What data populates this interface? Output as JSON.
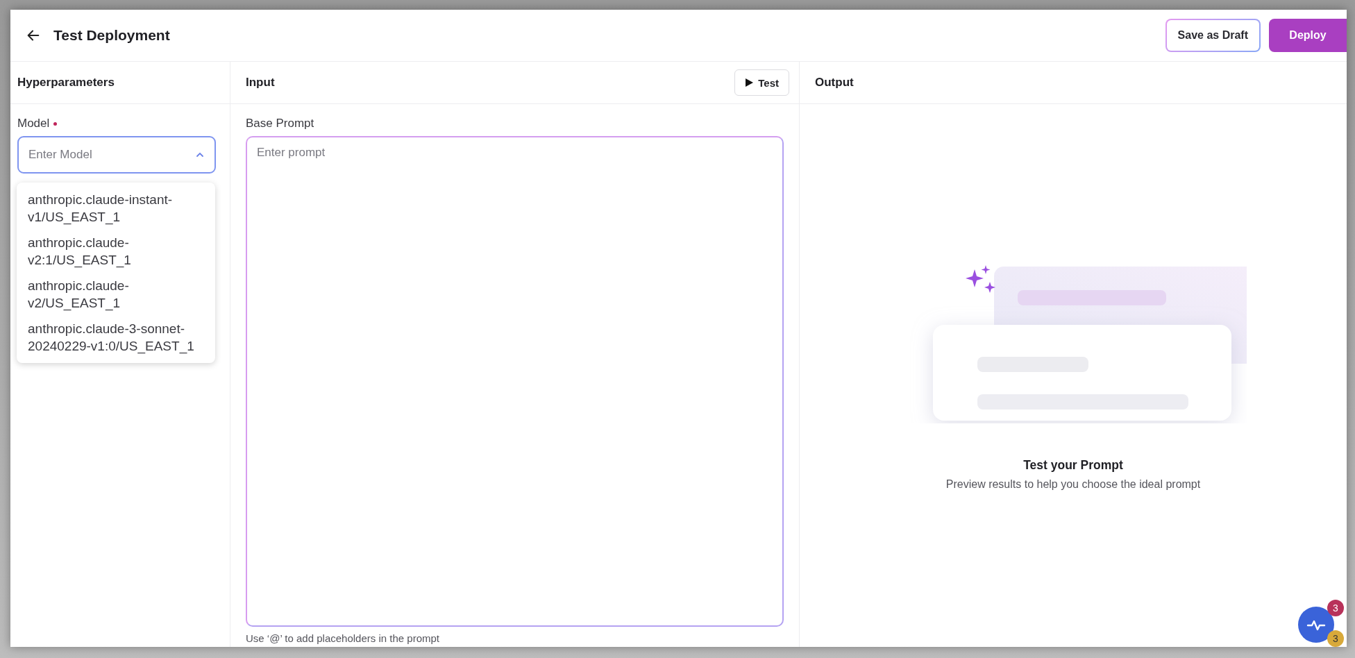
{
  "header": {
    "title": "Test Deployment",
    "buttons": [
      {
        "label": "Save as Draft",
        "kind": "outline"
      },
      {
        "label": "Deploy",
        "kind": "primary"
      }
    ]
  },
  "hyperparameters": {
    "heading": "Hyperparameters",
    "model_field": {
      "label": "Model",
      "required": true,
      "placeholder": "Enter Model",
      "expanded": true,
      "options": [
        "anthropic.claude-instant-v1/US_EAST_1",
        "anthropic.claude-v2:1/US_EAST_1",
        "anthropic.claude-v2/US_EAST_1",
        "anthropic.claude-3-sonnet-20240229-v1:0/US_EAST_1"
      ]
    }
  },
  "input": {
    "heading": "Input",
    "test_button": "Test",
    "base_prompt": {
      "label": "Base Prompt",
      "placeholder": "Enter prompt"
    },
    "hint": "Use ‘@’ to add placeholders in the prompt"
  },
  "output": {
    "heading": "Output",
    "empty_state": {
      "title": "Test your Prompt",
      "subtitle": "Preview results to help you choose the ideal prompt"
    }
  },
  "fab": {
    "badges": [
      {
        "count": "3",
        "color": "#b8325a"
      },
      {
        "count": "3",
        "color": "#d8a93a"
      }
    ]
  }
}
